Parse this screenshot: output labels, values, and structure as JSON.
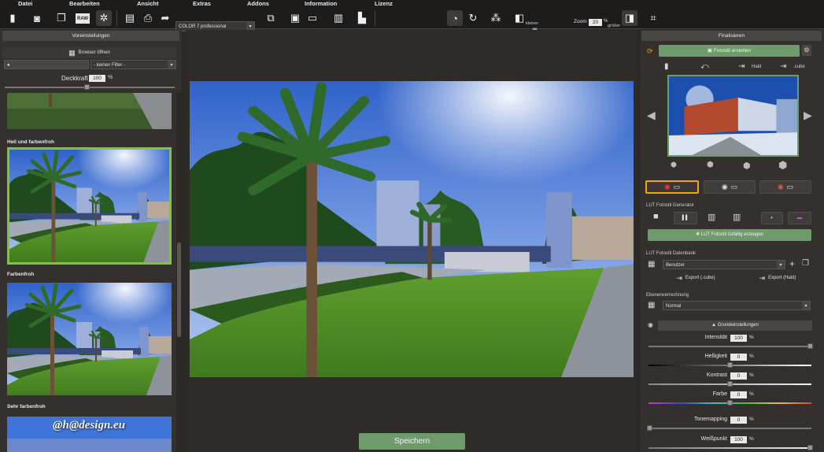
{
  "menu": [
    "Datei",
    "Bearbeiten",
    "Ansicht",
    "Extras",
    "Addons",
    "Information",
    "Lizenz"
  ],
  "toolbar": {
    "preset_select": "COLOR 7 professional",
    "zoom_label": "Zoom",
    "zoom_value": "20",
    "zoom_unit": "%",
    "smaller": "kleiner",
    "larger": "größer",
    "compare_icon_text": "RAW"
  },
  "left": {
    "header": "Voreinstellungen",
    "browser_button": "Browser öffnen",
    "filter_select": "- keinen Filter -",
    "opacity_label": "Deckkraft",
    "opacity_value": "100",
    "opacity_unit": "%",
    "opacity_level": 0.48,
    "presets": [
      {
        "label": "Hell und farbenfroh"
      },
      {
        "label": "Farbenfroh"
      },
      {
        "label": "Sehr farbenfroh"
      }
    ],
    "watermark": "@h@design.eu"
  },
  "center": {
    "save_button": "Speichern"
  },
  "right": {
    "header": "Finalisieren",
    "create_button": "Fotostil erstellen",
    "hald_label": "Hald",
    "cube_label": ".cube",
    "generator_label": "LUT Fotostil Generator",
    "random_button": "LUT Fotostil zufällig erzeugen",
    "database_label": "LUT Fotostil Datenbank",
    "db_select": "Benutzer",
    "export_cube": "Export (.cube)",
    "export_hald": "Export (Hald)",
    "blend_label": "Ebenenverrechnung",
    "blend_select": "Normal",
    "basic_settings": "Grundeinstellungen",
    "sliders": [
      {
        "label": "Intensität",
        "value": "100",
        "unit": "%",
        "level": 1.0
      },
      {
        "label": "Helligkeit",
        "value": "0",
        "unit": "%",
        "level": 0.5
      },
      {
        "label": "Kontrast",
        "value": "0",
        "unit": "%",
        "level": 0.5
      },
      {
        "label": "Farbe",
        "value": "0",
        "unit": "%",
        "level": 0.5
      },
      {
        "label": "Tonemapping",
        "value": "0",
        "unit": "%",
        "level": 0.0
      },
      {
        "label": "Weißpunkt",
        "value": "100",
        "unit": "%",
        "level": 1.0
      }
    ]
  }
}
